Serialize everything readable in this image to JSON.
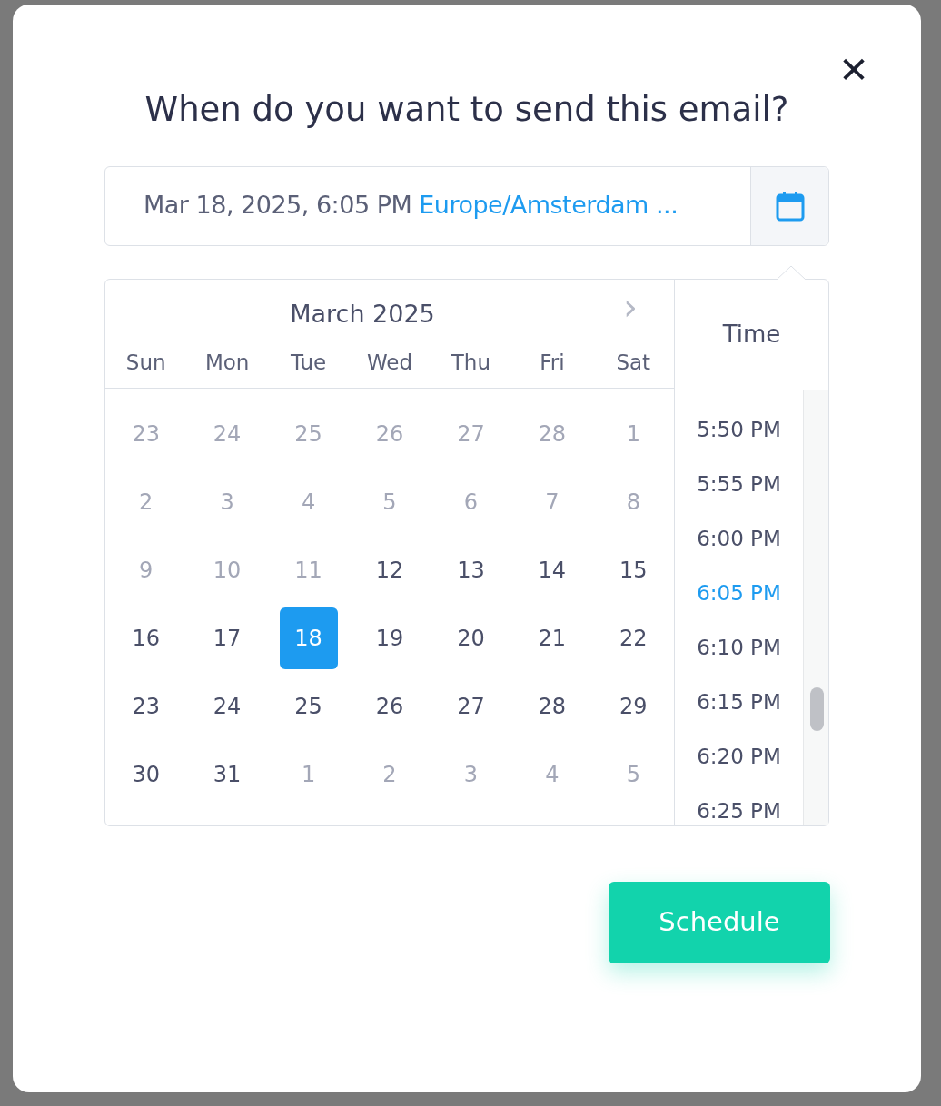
{
  "dialog": {
    "title": "When do you want to send this email?",
    "close_label": "✕"
  },
  "datetime_field": {
    "value": "Mar 18, 2025, 6:05 PM",
    "timezone": "Europe/Amsterdam ..."
  },
  "calendar": {
    "month": "March 2025",
    "next_label": "›",
    "weekdays": [
      "Sun",
      "Mon",
      "Tue",
      "Wed",
      "Thu",
      "Fri",
      "Sat"
    ],
    "days": [
      {
        "label": "23",
        "disabled": true,
        "selected": false
      },
      {
        "label": "24",
        "disabled": true,
        "selected": false
      },
      {
        "label": "25",
        "disabled": true,
        "selected": false
      },
      {
        "label": "26",
        "disabled": true,
        "selected": false
      },
      {
        "label": "27",
        "disabled": true,
        "selected": false
      },
      {
        "label": "28",
        "disabled": true,
        "selected": false
      },
      {
        "label": "1",
        "disabled": true,
        "selected": false
      },
      {
        "label": "2",
        "disabled": true,
        "selected": false
      },
      {
        "label": "3",
        "disabled": true,
        "selected": false
      },
      {
        "label": "4",
        "disabled": true,
        "selected": false
      },
      {
        "label": "5",
        "disabled": true,
        "selected": false
      },
      {
        "label": "6",
        "disabled": true,
        "selected": false
      },
      {
        "label": "7",
        "disabled": true,
        "selected": false
      },
      {
        "label": "8",
        "disabled": true,
        "selected": false
      },
      {
        "label": "9",
        "disabled": true,
        "selected": false
      },
      {
        "label": "10",
        "disabled": true,
        "selected": false
      },
      {
        "label": "11",
        "disabled": true,
        "selected": false
      },
      {
        "label": "12",
        "disabled": false,
        "selected": false
      },
      {
        "label": "13",
        "disabled": false,
        "selected": false
      },
      {
        "label": "14",
        "disabled": false,
        "selected": false
      },
      {
        "label": "15",
        "disabled": false,
        "selected": false
      },
      {
        "label": "16",
        "disabled": false,
        "selected": false
      },
      {
        "label": "17",
        "disabled": false,
        "selected": false
      },
      {
        "label": "18",
        "disabled": false,
        "selected": true
      },
      {
        "label": "19",
        "disabled": false,
        "selected": false
      },
      {
        "label": "20",
        "disabled": false,
        "selected": false
      },
      {
        "label": "21",
        "disabled": false,
        "selected": false
      },
      {
        "label": "22",
        "disabled": false,
        "selected": false
      },
      {
        "label": "23",
        "disabled": false,
        "selected": false
      },
      {
        "label": "24",
        "disabled": false,
        "selected": false
      },
      {
        "label": "25",
        "disabled": false,
        "selected": false
      },
      {
        "label": "26",
        "disabled": false,
        "selected": false
      },
      {
        "label": "27",
        "disabled": false,
        "selected": false
      },
      {
        "label": "28",
        "disabled": false,
        "selected": false
      },
      {
        "label": "29",
        "disabled": false,
        "selected": false
      },
      {
        "label": "30",
        "disabled": false,
        "selected": false
      },
      {
        "label": "31",
        "disabled": false,
        "selected": false
      },
      {
        "label": "1",
        "disabled": true,
        "selected": false
      },
      {
        "label": "2",
        "disabled": true,
        "selected": false
      },
      {
        "label": "3",
        "disabled": true,
        "selected": false
      },
      {
        "label": "4",
        "disabled": true,
        "selected": false
      },
      {
        "label": "5",
        "disabled": true,
        "selected": false
      }
    ]
  },
  "time": {
    "heading": "Time",
    "options": [
      {
        "label": "5:50 PM",
        "selected": false
      },
      {
        "label": "5:55 PM",
        "selected": false
      },
      {
        "label": "6:00 PM",
        "selected": false
      },
      {
        "label": "6:05 PM",
        "selected": true
      },
      {
        "label": "6:10 PM",
        "selected": false
      },
      {
        "label": "6:15 PM",
        "selected": false
      },
      {
        "label": "6:20 PM",
        "selected": false
      },
      {
        "label": "6:25 PM",
        "selected": false
      }
    ]
  },
  "schedule_button": "Schedule"
}
